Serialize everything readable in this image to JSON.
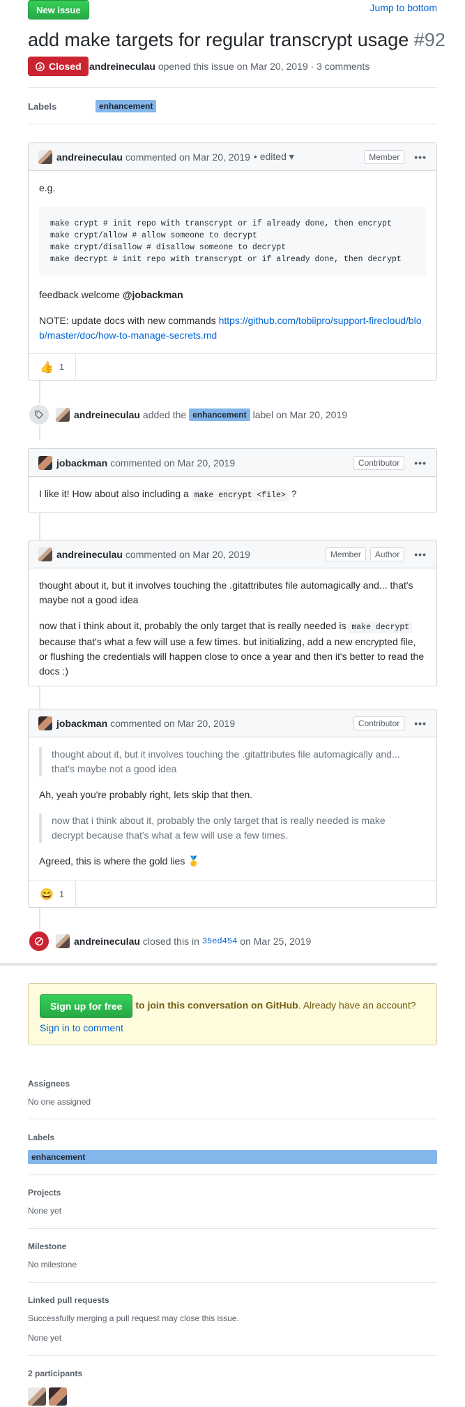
{
  "top": {
    "new_issue": "New issue",
    "jump": "Jump to bottom"
  },
  "issue": {
    "title": "add make targets for regular transcrypt usage",
    "number": "#92",
    "state": "Closed",
    "author": "andreineculau",
    "opened_text": "opened this issue on Mar 20, 2019 · 3 comments"
  },
  "labels_row": {
    "heading": "Labels",
    "label": "enhancement"
  },
  "comments": [
    {
      "author": "andreineculau",
      "meta": "commented on Mar 20, 2019",
      "edited": "• edited ▾",
      "badges": [
        "Member"
      ],
      "intro": "e.g.",
      "code": "make crypt # init repo with transcrypt or if already done, then encrypt\nmake crypt/allow # allow someone to decrypt\nmake crypt/disallow # disallow someone to decrypt\nmake decrypt # init repo with transcrypt or if already done, then decrypt",
      "feedback": "feedback welcome",
      "mention": "@jobackman",
      "note": "NOTE: update docs with new commands",
      "note_link": "https://github.com/tobiipro/support-firecloud/blob/master/doc/how-to-manage-secrets.md",
      "reaction_emoji": "👍",
      "reaction_count": "1"
    },
    {
      "author": "jobackman",
      "meta": "commented on Mar 20, 2019",
      "badges": [
        "Contributor"
      ],
      "text_before": "I like it! How about also including a",
      "code_inline": "make encrypt <file>",
      "text_after": "?"
    },
    {
      "author": "andreineculau",
      "meta": "commented on Mar 20, 2019",
      "badges": [
        "Member",
        "Author"
      ],
      "p1": "thought about it, but it involves touching the .gitattributes file automagically and... that's maybe not a good idea",
      "p2_before": "now that i think about it, probably the only target that is really needed is",
      "p2_code": "make decrypt",
      "p2_after": "because that's what a few will use a few times. but initializing, add a new encrypted file, or flushing the credentials will happen close to once a year and then it's better to read the docs :)"
    },
    {
      "author": "jobackman",
      "meta": "commented on Mar 20, 2019",
      "badges": [
        "Contributor"
      ],
      "quote1": "thought about it, but it involves touching the .gitattributes file automagically and... that's maybe not a good idea",
      "reply1": "Ah, yeah you're probably right, lets skip that then.",
      "quote2": "now that i think about it, probably the only target that is really needed is make decrypt because that's what a few will use a few times.",
      "reply2": "Agreed, this is where the gold lies",
      "reply2_emoji": "🥇",
      "reaction_emoji": "😄",
      "reaction_count": "1"
    }
  ],
  "events": {
    "labeled": {
      "actor": "andreineculau",
      "pre": "added the",
      "label": "enhancement",
      "post": "label on Mar 20, 2019"
    },
    "closed": {
      "actor": "andreineculau",
      "pre": "closed this in",
      "commit": "35ed454",
      "post": "on Mar 25, 2019"
    }
  },
  "signup": {
    "button": "Sign up for free",
    "bold": "to join this conversation on GitHub",
    "rest": ". Already have an account?",
    "link": "Sign in to comment"
  },
  "sidebar": {
    "assignees": {
      "heading": "Assignees",
      "value": "No one assigned"
    },
    "labels": {
      "heading": "Labels",
      "value": "enhancement"
    },
    "projects": {
      "heading": "Projects",
      "value": "None yet"
    },
    "milestone": {
      "heading": "Milestone",
      "value": "No milestone"
    },
    "linked": {
      "heading": "Linked pull requests",
      "desc": "Successfully merging a pull request may close this issue.",
      "value": "None yet"
    },
    "participants": {
      "heading": "2 participants"
    }
  },
  "colors": {
    "green": "#28a745",
    "closed_red": "#cb2431",
    "link": "#0366d6",
    "label_bg": "#84b6eb"
  }
}
